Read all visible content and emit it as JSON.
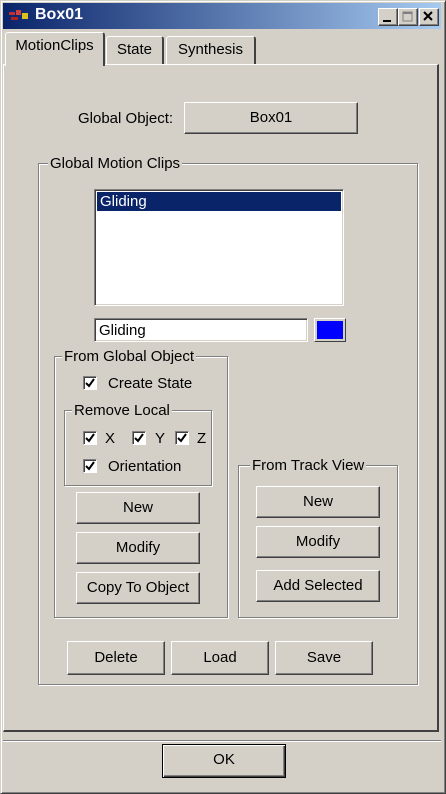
{
  "window": {
    "title": "Box01"
  },
  "tabs": [
    "MotionClips",
    "State",
    "Synthesis"
  ],
  "global_object": {
    "label": "Global Object:",
    "button": "Box01"
  },
  "global_motion_clips": {
    "label": "Global Motion Clips",
    "list_items": [
      "Gliding"
    ],
    "name_field_value": "Gliding",
    "color": "#0000ff"
  },
  "from_global_object": {
    "label": "From Global Object",
    "create_state": {
      "label": "Create State",
      "checked": true
    },
    "remove_local": {
      "label": "Remove Local",
      "x": {
        "label": "X",
        "checked": true
      },
      "y": {
        "label": "Y",
        "checked": true
      },
      "z": {
        "label": "Z",
        "checked": true
      },
      "orientation": {
        "label": "Orientation",
        "checked": true
      }
    },
    "buttons": {
      "new": "New",
      "modify": "Modify",
      "copy_to_object": "Copy To Object"
    }
  },
  "from_track_view": {
    "label": "From Track View",
    "buttons": {
      "new": "New",
      "modify": "Modify",
      "add_selected": "Add Selected"
    }
  },
  "bottom_buttons": {
    "delete": "Delete",
    "load": "Load",
    "save": "Save"
  },
  "ok_button": "OK"
}
